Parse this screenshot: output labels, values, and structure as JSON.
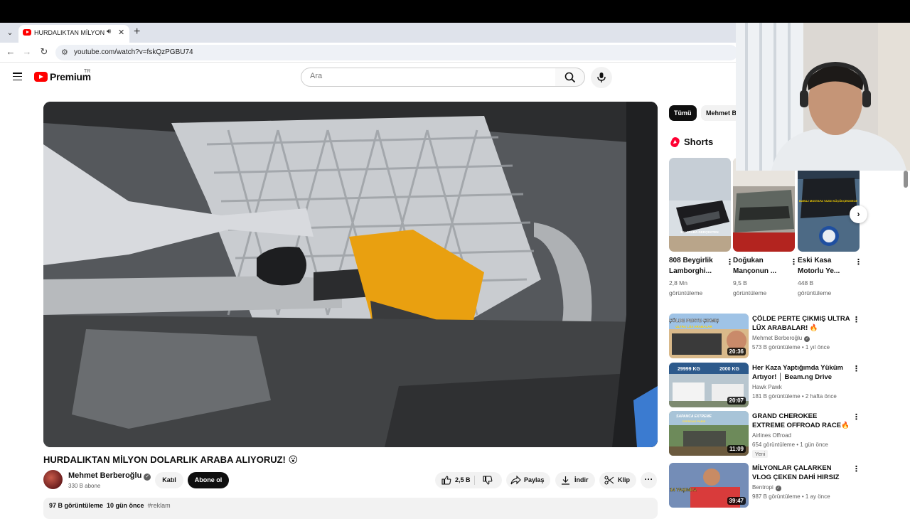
{
  "browser": {
    "tab_title": "HURDALIKTAN MİLYON DO",
    "url": "youtube.com/watch?v=fskQzPGBU74"
  },
  "header": {
    "logo_text": "Premium",
    "region": "TR",
    "search_placeholder": "Ara"
  },
  "video": {
    "title": "HURDALIKTAN MİLYON DOLARLIK ARABA ALIYORUZ! 😮",
    "channel": "Mehmet Berberoğlu",
    "subscribers": "330 B abone",
    "join_label": "Katıl",
    "subscribe_label": "Abone ol",
    "likes": "2,5 B",
    "share_label": "Paylaş",
    "download_label": "İndir",
    "clip_label": "Klip",
    "views": "97 B görüntüleme",
    "date": "10 gün önce",
    "tag": "#reklam"
  },
  "sidebar": {
    "chips": [
      "Tümü",
      "Mehmet B"
    ],
    "shorts_label": "Shorts",
    "shorts": [
      {
        "title_line1": "808 Beygirlik",
        "title_line2": "Lamborghi...",
        "views_line1": "2,8 Mn",
        "views_line2": "görüntüleme",
        "thumb_text": "BU ARABA GERÇEKTEN"
      },
      {
        "title_line1": "Doğukan",
        "title_line2": "Mançonun ...",
        "views_line1": "9,5 B",
        "views_line2": "görüntüleme",
        "thumb_text": ""
      },
      {
        "title_line1": "Eski Kasa",
        "title_line2": "Motorlu Ye...",
        "views_line1": "448 B",
        "views_line2": "görüntüleme",
        "thumb_text": "BARAJ MUSTAFA YAZDI KÜÇÜKÇEKMECE"
      }
    ],
    "recommendations": [
      {
        "title": "ÇÖLDE PERTE ÇIKMIŞ ULTRA LÜX ARABALAR! 🔥",
        "channel": "Mehmet Berberoğlu",
        "verified": true,
        "meta": "573 B görüntüleme • 1 yıl önce",
        "duration": "20:36",
        "thumb_text": "ÇÖLDE PERTE ÇIKMIŞ",
        "thumb_sub": "ULTRA LÜX ARABALAR",
        "badge": ""
      },
      {
        "title": "Her Kaza Yaptığımda Yüküm Artıyor! │ Beam.ng Drive",
        "channel": "Hawk Pawk",
        "verified": false,
        "meta": "181 B görüntüleme • 2 hafta önce",
        "duration": "20:07",
        "thumb_text": "29999 KG",
        "thumb_sub": "2000 KG",
        "badge": ""
      },
      {
        "title": "GRAND CHEROKEE EXTREME OFFROAD RACE🔥 - Sapanca ...",
        "channel": "Airlines Offroad",
        "verified": false,
        "meta": "654 görüntüleme • 1 gün önce",
        "duration": "11:09",
        "thumb_text": "SAPANCA EXTREME",
        "thumb_sub": "OFFROAD PARIS",
        "badge": "Yeni"
      },
      {
        "title": "MİLYONLAR ÇALARKEN VLOG ÇEKEN DAHİ HIRSIZ",
        "channel": "Bentropi",
        "verified": true,
        "meta": "987 B görüntüleme • 1 ay önce",
        "duration": "39:47",
        "thumb_text": "14 YAŞINDA",
        "thumb_sub": "",
        "badge": ""
      }
    ]
  },
  "colors": {
    "brand_red": "#ff0000",
    "text_primary": "#0f0f0f",
    "text_secondary": "#606060",
    "chip_bg": "#f2f2f2"
  }
}
